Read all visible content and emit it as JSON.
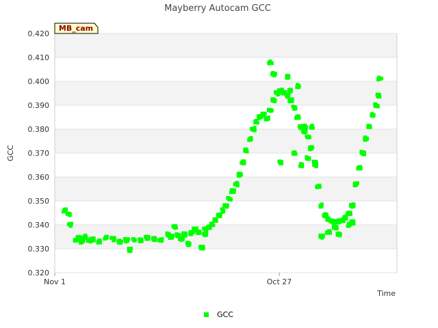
{
  "chart_data": {
    "type": "scatter",
    "title": "Mayberry Autocam GCC",
    "xlabel": "Time",
    "ylabel": "GCC",
    "badge": "MB_cam",
    "ylim": [
      0.32,
      0.42
    ],
    "yticks": [
      "0.420",
      "0.410",
      "0.400",
      "0.390",
      "0.380",
      "0.370",
      "0.360",
      "0.350",
      "0.340",
      "0.330",
      "0.320"
    ],
    "xticks": [
      "Nov 1",
      "Oct 27"
    ],
    "legend_position": "bottom",
    "grid": true,
    "series": [
      {
        "name": "GCC",
        "color": "#00ff00",
        "points": [
          [
            0.03,
            0.346
          ],
          [
            0.04,
            0.3445
          ],
          [
            0.045,
            0.34
          ],
          [
            0.06,
            0.3335
          ],
          [
            0.07,
            0.3345
          ],
          [
            0.08,
            0.333
          ],
          [
            0.09,
            0.335
          ],
          [
            0.1,
            0.3335
          ],
          [
            0.11,
            0.334
          ],
          [
            0.15,
            0.3345
          ],
          [
            0.17,
            0.334
          ],
          [
            0.19,
            0.333
          ],
          [
            0.21,
            0.3335
          ],
          [
            0.23,
            0.334
          ],
          [
            0.25,
            0.3335
          ],
          [
            0.27,
            0.3345
          ],
          [
            0.29,
            0.334
          ],
          [
            0.31,
            0.3335
          ],
          [
            0.34,
            0.335
          ],
          [
            0.36,
            0.3355
          ],
          [
            0.38,
            0.336
          ],
          [
            0.4,
            0.3365
          ],
          [
            0.42,
            0.337
          ],
          [
            0.44,
            0.338
          ],
          [
            0.45,
            0.339
          ],
          [
            0.46,
            0.34
          ],
          [
            0.47,
            0.342
          ],
          [
            0.48,
            0.344
          ],
          [
            0.49,
            0.346
          ],
          [
            0.5,
            0.348
          ],
          [
            0.51,
            0.351
          ],
          [
            0.52,
            0.354
          ],
          [
            0.53,
            0.357
          ],
          [
            0.54,
            0.361
          ],
          [
            0.55,
            0.366
          ],
          [
            0.56,
            0.371
          ],
          [
            0.57,
            0.376
          ],
          [
            0.58,
            0.38
          ],
          [
            0.59,
            0.383
          ],
          [
            0.6,
            0.385
          ],
          [
            0.61,
            0.386
          ],
          [
            0.62,
            0.3845
          ],
          [
            0.63,
            0.388
          ],
          [
            0.64,
            0.392
          ],
          [
            0.65,
            0.395
          ],
          [
            0.66,
            0.396
          ],
          [
            0.67,
            0.395
          ],
          [
            0.68,
            0.394
          ],
          [
            0.69,
            0.392
          ],
          [
            0.7,
            0.389
          ],
          [
            0.71,
            0.385
          ],
          [
            0.72,
            0.381
          ],
          [
            0.73,
            0.379
          ],
          [
            0.74,
            0.377
          ],
          [
            0.75,
            0.372
          ],
          [
            0.76,
            0.365
          ],
          [
            0.77,
            0.356
          ],
          [
            0.78,
            0.348
          ],
          [
            0.79,
            0.344
          ],
          [
            0.8,
            0.3425
          ],
          [
            0.81,
            0.3415
          ],
          [
            0.82,
            0.341
          ],
          [
            0.83,
            0.3415
          ],
          [
            0.84,
            0.342
          ],
          [
            0.85,
            0.343
          ],
          [
            0.86,
            0.345
          ],
          [
            0.87,
            0.348
          ],
          [
            0.88,
            0.357
          ],
          [
            0.89,
            0.364
          ],
          [
            0.9,
            0.37
          ],
          [
            0.91,
            0.376
          ],
          [
            0.92,
            0.381
          ],
          [
            0.93,
            0.386
          ],
          [
            0.94,
            0.39
          ],
          [
            0.945,
            0.394
          ],
          [
            0.95,
            0.401
          ],
          [
            0.63,
            0.408
          ],
          [
            0.64,
            0.403
          ],
          [
            0.66,
            0.366
          ],
          [
            0.68,
            0.402
          ],
          [
            0.7,
            0.37
          ],
          [
            0.72,
            0.365
          ],
          [
            0.74,
            0.368
          ],
          [
            0.76,
            0.366
          ],
          [
            0.78,
            0.335
          ],
          [
            0.8,
            0.337
          ],
          [
            0.82,
            0.339
          ],
          [
            0.83,
            0.336
          ],
          [
            0.86,
            0.34
          ],
          [
            0.87,
            0.341
          ],
          [
            0.69,
            0.396
          ],
          [
            0.71,
            0.398
          ],
          [
            0.73,
            0.381
          ],
          [
            0.75,
            0.381
          ],
          [
            0.22,
            0.3295
          ],
          [
            0.43,
            0.3305
          ],
          [
            0.13,
            0.333
          ],
          [
            0.33,
            0.336
          ],
          [
            0.35,
            0.339
          ],
          [
            0.37,
            0.334
          ],
          [
            0.39,
            0.332
          ],
          [
            0.41,
            0.338
          ],
          [
            0.44,
            0.336
          ]
        ]
      }
    ]
  }
}
